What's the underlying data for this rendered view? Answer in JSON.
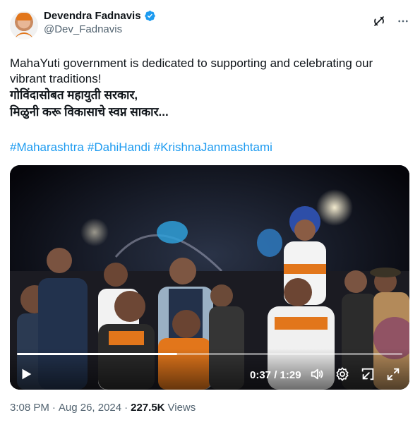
{
  "author": {
    "name": "Devendra Fadnavis",
    "handle": "@Dev_Fadnavis",
    "verified": true
  },
  "tweet": {
    "text_line1": "MahaYuti government is dedicated to supporting and celebrating our",
    "text_line2": "vibrant traditions!",
    "marathi_line1": "गोविंदासोबत महायुती सरकार,",
    "marathi_line2": "मिळुनी करू विकासाचे स्वप्न साकार...",
    "hashtags": [
      "#Maharashtra",
      "#DahiHandi",
      "#KrishnaJanmashtami"
    ]
  },
  "video": {
    "current_time": "0:37",
    "separator": "/",
    "duration": "1:29",
    "progress_fraction": 0.415
  },
  "meta": {
    "time": "3:08 PM",
    "dot1": "·",
    "date": "Aug 26, 2024",
    "dot2": "·",
    "views_count": "227.5K",
    "views_label": "Views"
  },
  "colors": {
    "link": "#1d9bf0",
    "verified": "#1d9bf0",
    "secondary_text": "#536471"
  },
  "icons": [
    "verified-badge-icon",
    "grok-icon",
    "more-icon",
    "play-icon",
    "volume-icon",
    "settings-icon",
    "pip-icon",
    "fullscreen-icon"
  ]
}
